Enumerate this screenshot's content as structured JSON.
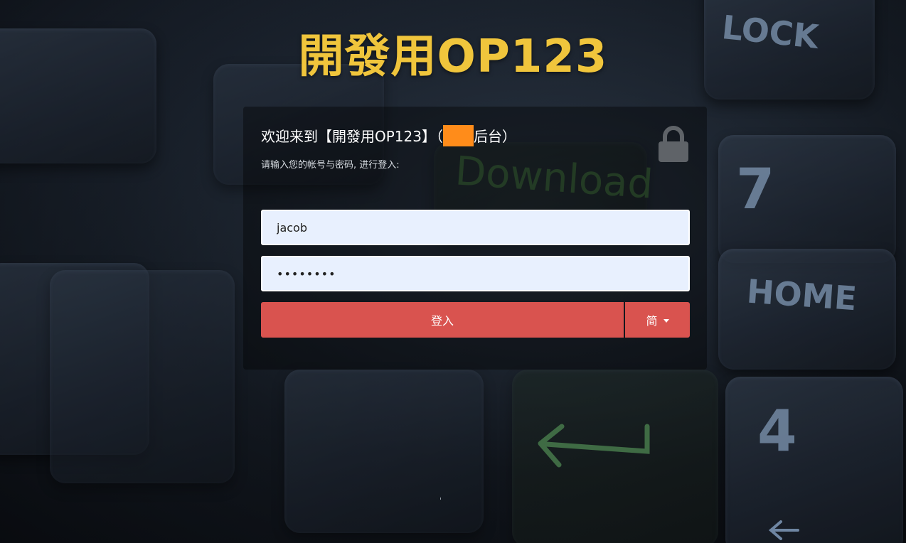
{
  "site": {
    "title": "開發用OP123"
  },
  "login": {
    "welcome_prefix": "欢迎来到【開發用OP123】（",
    "welcome_suffix": "后台）",
    "subtitle": "请输入您的帐号与密码, 进行登入:",
    "username_value": "jacob",
    "password_value": "••••••••",
    "login_button_label": "登入",
    "language_label": "简"
  },
  "background": {
    "key_labels": [
      "LOCK",
      "7",
      "HOME",
      "4",
      "Download"
    ]
  },
  "colors": {
    "title": "#f0c53c",
    "button": "#d9534f",
    "highlight_block": "#ff8c1a",
    "input_bg": "#e8f0fe"
  },
  "icons": {
    "lock": "lock-icon",
    "language_caret": "caret-down-icon"
  }
}
